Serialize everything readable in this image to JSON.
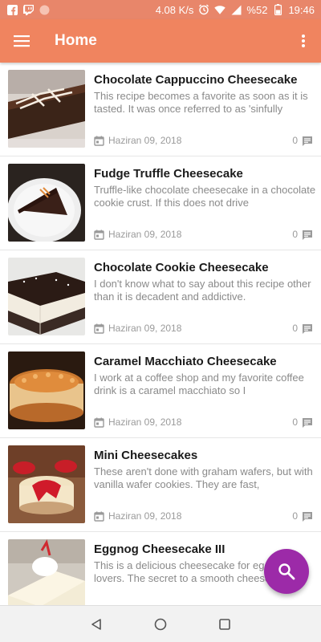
{
  "status_bar": {
    "speed": "4.08 K/s",
    "battery": "%52",
    "time": "19:46"
  },
  "app_bar": {
    "title": "Home"
  },
  "posts": [
    {
      "title": "Chocolate Cappuccino Cheesecake",
      "description": "This recipe becomes a favorite as soon as it is tasted. It was once referred to as 'sinfully",
      "date": "Haziran 09, 2018",
      "comments": "0"
    },
    {
      "title": "Fudge Truffle Cheesecake",
      "description": "Truffle-like chocolate cheesecake in a chocolate cookie crust. If this does not drive",
      "date": "Haziran 09, 2018",
      "comments": "0"
    },
    {
      "title": "Chocolate Cookie Cheesecake",
      "description": "I don't know what to say about this recipe other than it is decadent and addictive.",
      "date": "Haziran 09, 2018",
      "comments": "0"
    },
    {
      "title": "Caramel Macchiato Cheesecake",
      "description": "I work at a coffee shop and my favorite coffee drink is a caramel macchiato so I",
      "date": "Haziran 09, 2018",
      "comments": "0"
    },
    {
      "title": "Mini Cheesecakes",
      "description": "These aren't done with graham wafers, but with vanilla wafer cookies. They are fast,",
      "date": "Haziran 09, 2018",
      "comments": "0"
    },
    {
      "title": "Eggnog Cheesecake III",
      "description": "This is a delicious cheesecake for eggnog lovers. The secret to a smooth cheesecake",
      "date": "",
      "comments": ""
    }
  ],
  "colors": {
    "status_bar": "#e8866a",
    "app_bar": "#f0845f",
    "fab": "#9c2aa8"
  },
  "icons": {
    "menu": "hamburger-icon",
    "overflow": "more-vert-icon",
    "fab": "search-icon",
    "date": "calendar-icon",
    "comments": "comment-icon"
  }
}
